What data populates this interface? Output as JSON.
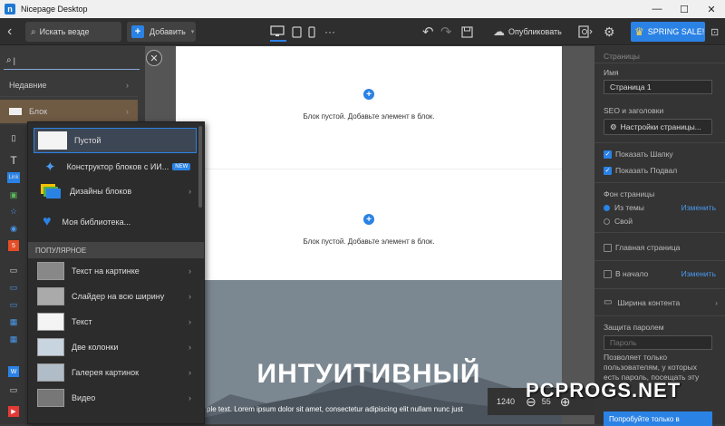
{
  "window": {
    "title": "Nicepage Desktop",
    "min": "—",
    "max": "☐",
    "close": "✕"
  },
  "toolbar": {
    "back": "‹",
    "search_placeholder": "Искать везде",
    "add_label": "Добавить",
    "more": "···",
    "publish_label": "Опубликовать",
    "sale_label": "SPRING SALE!"
  },
  "leftpanel": {
    "search_value": "|",
    "recent": "Недавние",
    "block": "Блок",
    "icons": [
      "▯",
      "T",
      "Link",
      "▣",
      "☆",
      "◉",
      "5",
      "▭",
      "▭",
      "▭",
      "▦",
      "▦",
      "W",
      "▭",
      "▶"
    ]
  },
  "menu": {
    "items": [
      {
        "label": "Пустой"
      },
      {
        "label": "Конструктор блоков с ИИ...",
        "badge": "NEW"
      },
      {
        "label": "Дизайны блоков"
      },
      {
        "label": "Моя библиотека..."
      }
    ],
    "popular_header": "ПОПУЛЯРНОЕ",
    "popular": [
      "Текст на картинке",
      "Слайдер на всю ширину",
      "Текст",
      "Две колонки",
      "Галерея картинок",
      "Видео"
    ]
  },
  "canvas": {
    "empty_block_1": "Блок пустой. Добавьте элемент в блок.",
    "empty_block_2": "Блок пустой. Добавьте элемент в блок.",
    "hero_title": "ИНТУИТИВНЫЙ",
    "hero_text": "ple text. Lorem ipsum dolor sit amet, consectetur adipiscing elit nullam nunc just",
    "zoom_width": "1240",
    "zoom_value": "55"
  },
  "rightpanel": {
    "header": "Страницы",
    "name_label": "Имя",
    "name_value": "Страница 1",
    "seo_label": "SEO и заголовки",
    "settings_btn": "Настройки страницы...",
    "show_header": "Показать Шапку",
    "show_footer": "Показать Подвал",
    "bg_label": "Фон страницы",
    "from_theme": "Из темы",
    "change": "Изменить",
    "own": "Свой",
    "home_page": "Главная страница",
    "to_top": "В начало",
    "change2": "Изменить",
    "content_width": "Ширина контента",
    "password_label": "Защита паролем",
    "password_placeholder": "Пароль",
    "password_desc1": "Позволяет только",
    "password_desc2": "пользователям, у которых",
    "password_desc3": "есть пароль, посещать эту",
    "try_label": "Попробуйте только в"
  },
  "watermark": "PCPROGS.NET",
  "colors": {
    "accent": "#2b82e5",
    "block_row": "#6f5a44",
    "hero": "#7c8891"
  }
}
